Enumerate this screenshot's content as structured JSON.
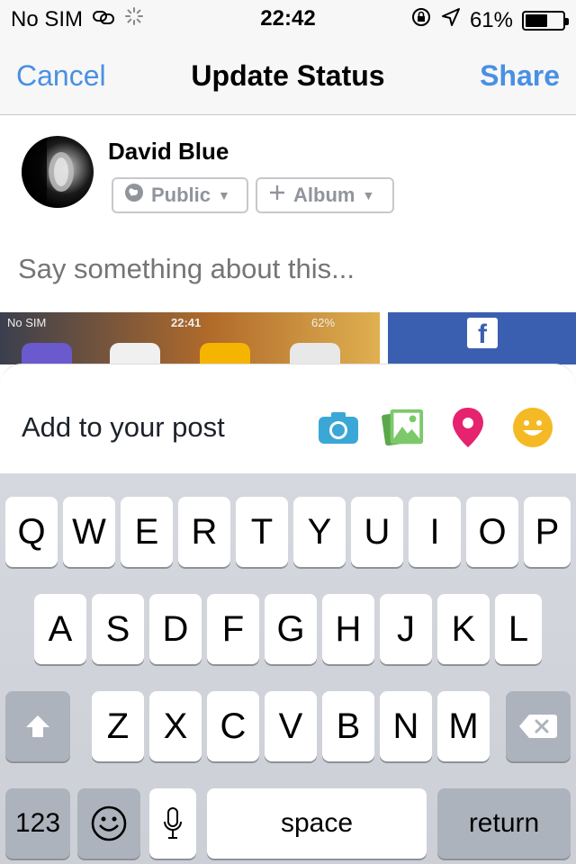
{
  "status_bar": {
    "carrier": "No SIM",
    "time": "22:42",
    "battery": "61%",
    "battery_level": 0.61
  },
  "nav": {
    "cancel": "Cancel",
    "title": "Update Status",
    "share": "Share"
  },
  "composer": {
    "user_name": "David Blue",
    "privacy": "Public",
    "album": "Album",
    "placeholder": "Say something about this..."
  },
  "thumbnails": {
    "ios_shot": {
      "carrier": "No SIM",
      "time": "22:41",
      "battery": "62%"
    },
    "facebook_logo": "f"
  },
  "add_to_post": {
    "label": "Add to your post",
    "icons": [
      "camera-icon",
      "photo-icon",
      "location-icon",
      "feeling-icon"
    ]
  },
  "keyboard": {
    "row1": [
      "Q",
      "W",
      "E",
      "R",
      "T",
      "Y",
      "U",
      "I",
      "O",
      "P"
    ],
    "row2": [
      "A",
      "S",
      "D",
      "F",
      "G",
      "H",
      "J",
      "K",
      "L"
    ],
    "row3": [
      "Z",
      "X",
      "C",
      "V",
      "B",
      "N",
      "M"
    ],
    "numbers": "123",
    "space": "space",
    "return": "return"
  },
  "colors": {
    "accent_blue": "#4a90e2",
    "camera": "#3ba7d6",
    "photo": "#6bbf59",
    "location": "#e6236f",
    "feeling": "#f5b925"
  }
}
